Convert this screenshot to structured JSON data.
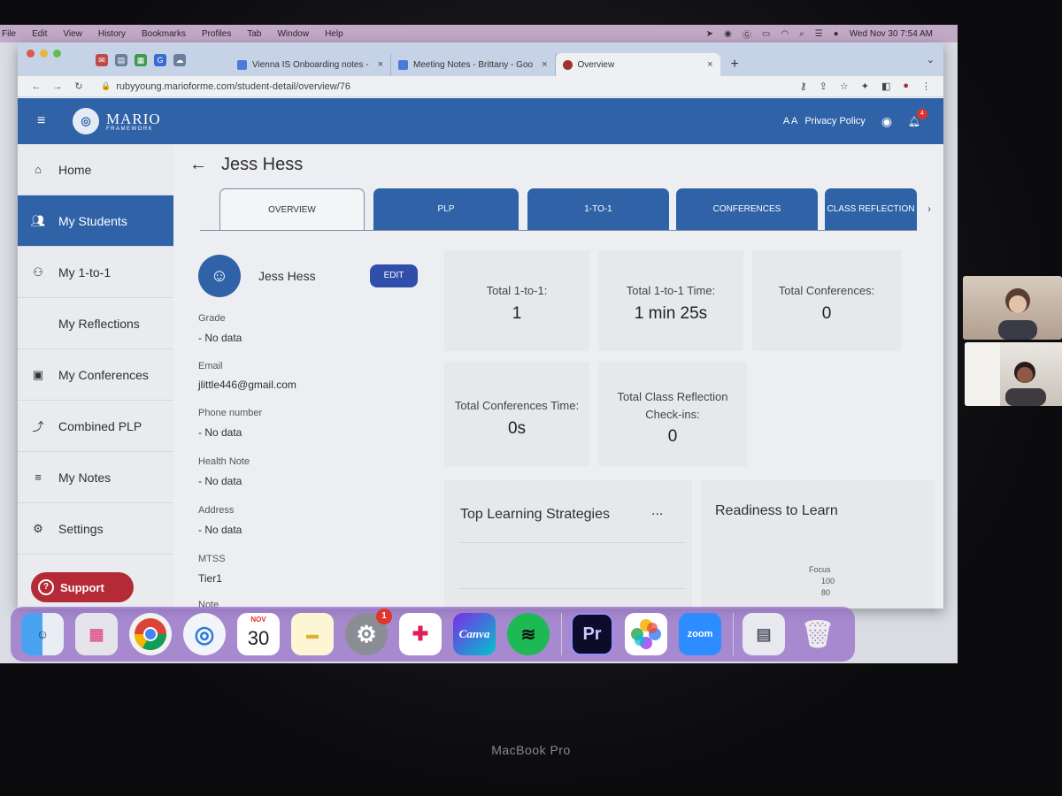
{
  "menubar": {
    "items": [
      "File",
      "Edit",
      "View",
      "History",
      "Bookmarks",
      "Profiles",
      "Tab",
      "Window",
      "Help"
    ],
    "datetime": "Wed Nov 30  7:54 AM"
  },
  "browser": {
    "tabs": [
      {
        "label": "Vienna IS Onboarding notes -"
      },
      {
        "label": "Meeting Notes - Brittany - Goo"
      },
      {
        "label": "Overview"
      }
    ],
    "url": "rubyyoung.marioforme.com/student-detail/overview/76"
  },
  "app": {
    "logo_title": "MARIO",
    "logo_subtitle": "FRAMEWORK",
    "font_size_label": "A A",
    "privacy_label": "Privacy Policy",
    "notification_count": "4",
    "colors": {
      "primary": "#2f62a7",
      "support": "#b52a37"
    }
  },
  "sidebar": {
    "items": [
      {
        "label": "Home",
        "icon": "home-icon"
      },
      {
        "label": "My Students",
        "icon": "students-icon",
        "active": true
      },
      {
        "label": "My 1-to-1",
        "icon": "people-icon"
      },
      {
        "label": "My Reflections",
        "icon": ""
      },
      {
        "label": "My Conferences",
        "icon": "conference-icon"
      },
      {
        "label": "Combined PLP",
        "icon": "trend-icon"
      },
      {
        "label": "My Notes",
        "icon": "notes-icon"
      },
      {
        "label": "Settings",
        "icon": "gear-icon"
      }
    ],
    "support_label": "Support"
  },
  "page": {
    "title": "Jess Hess",
    "tabs": [
      "OVERVIEW",
      "PLP",
      "1-TO-1",
      "CONFERENCES",
      "CLASS REFLECTION"
    ]
  },
  "profile": {
    "name": "Jess Hess",
    "edit_label": "EDIT",
    "fields": [
      {
        "label": "Grade",
        "value": "- No data"
      },
      {
        "label": "Email",
        "value": "jlittle446@gmail.com"
      },
      {
        "label": "Phone number",
        "value": "- No data"
      },
      {
        "label": "Health Note",
        "value": "- No data"
      },
      {
        "label": "Address",
        "value": "- No data"
      },
      {
        "label": "MTSS",
        "value": "Tier1"
      },
      {
        "label": "Note",
        "value": ""
      }
    ]
  },
  "stats": [
    {
      "label": "Total 1-to-1:",
      "value": "1"
    },
    {
      "label": "Total 1-to-1 Time:",
      "value": "1 min 25s"
    },
    {
      "label": "Total Conferences:",
      "value": "0"
    },
    {
      "label": "Total Conferences Time:",
      "value": "0s"
    },
    {
      "label": "Total Class Reflection Check-ins:",
      "value": "0"
    }
  ],
  "panels": {
    "strategies_title": "Top Learning Strategies",
    "strategies_menu": "...",
    "readiness_title": "Readiness to Learn",
    "readiness_axis_label": "Focus",
    "readiness_ticks": [
      "100",
      "80"
    ]
  },
  "dock": {
    "calendar_month": "NOV",
    "calendar_day": "30",
    "settings_badge": "1",
    "apps": [
      "Finder",
      "Launchpad",
      "Chrome",
      "Safari",
      "Calendar",
      "Notes",
      "System Settings",
      "Slack",
      "Canva",
      "Spotify",
      "Premiere Pro",
      "Photos",
      "Zoom"
    ],
    "canva_label": "Canva",
    "premiere_label": "Pr",
    "zoom_label": "zoom"
  },
  "device_label": "MacBook Pro"
}
